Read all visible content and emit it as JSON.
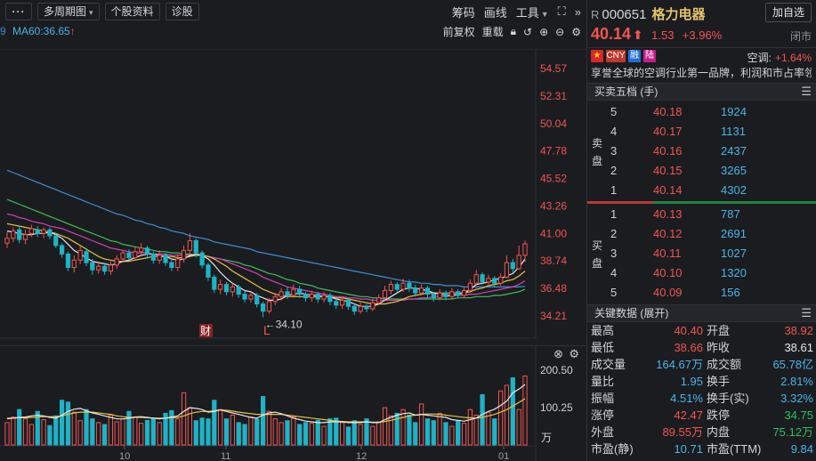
{
  "toolbar": {
    "menu_label": "···",
    "period_label": "多周期图",
    "profile_label": "个股资料",
    "diagnose_label": "诊股",
    "chips_label": "筹码",
    "draw_label": "画线",
    "tools_label": "工具"
  },
  "indicators": {
    "ma_prev_tail": "9",
    "ma60_label": "MA60:36.65",
    "ma60_arrow": "↑",
    "adjust_label": "前复权",
    "overlay_label": "重载"
  },
  "main_chart": {
    "price_ticks": [
      "54.57",
      "52.31",
      "50.04",
      "47.78",
      "45.52",
      "43.26",
      "41.00",
      "38.74",
      "36.48",
      "34.21"
    ],
    "tick_min": 34.21,
    "tick_max": 54.57,
    "low_annotation": "←34.10",
    "low_value": 34.1,
    "badge_finance": "财",
    "badge_l": "L",
    "colors": {
      "up": "#f2554f",
      "down": "#1fb3c6",
      "ma5": "#e8e8e8",
      "ma10": "#e7c244",
      "ma20": "#d53fb6",
      "ma30": "#3fbf59",
      "ma60": "#3b8fd9"
    },
    "candles": [
      {
        "o": 40.2,
        "c": 40.6,
        "h": 41.1,
        "l": 39.8
      },
      {
        "o": 40.6,
        "c": 41.2,
        "h": 41.5,
        "l": 40.3
      },
      {
        "o": 41.3,
        "c": 40.5,
        "h": 41.6,
        "l": 40.2
      },
      {
        "o": 40.5,
        "c": 40.9,
        "h": 41.3,
        "l": 40.1
      },
      {
        "o": 41.0,
        "c": 41.4,
        "h": 41.7,
        "l": 40.7
      },
      {
        "o": 41.3,
        "c": 41.0,
        "h": 41.6,
        "l": 40.7
      },
      {
        "o": 41.0,
        "c": 41.3,
        "h": 41.5,
        "l": 40.6
      },
      {
        "o": 41.3,
        "c": 40.8,
        "h": 41.5,
        "l": 40.5
      },
      {
        "o": 40.8,
        "c": 40.0,
        "h": 41.0,
        "l": 39.8
      },
      {
        "o": 40.0,
        "c": 39.3,
        "h": 40.2,
        "l": 39.0
      },
      {
        "o": 39.3,
        "c": 38.2,
        "h": 39.5,
        "l": 37.9
      },
      {
        "o": 38.2,
        "c": 38.8,
        "h": 39.2,
        "l": 37.8
      },
      {
        "o": 38.8,
        "c": 39.6,
        "h": 40.0,
        "l": 38.5
      },
      {
        "o": 39.5,
        "c": 38.6,
        "h": 39.8,
        "l": 38.3
      },
      {
        "o": 38.6,
        "c": 38.0,
        "h": 38.9,
        "l": 37.6
      },
      {
        "o": 38.0,
        "c": 38.3,
        "h": 38.6,
        "l": 37.7
      },
      {
        "o": 38.3,
        "c": 37.9,
        "h": 38.6,
        "l": 37.6
      },
      {
        "o": 37.9,
        "c": 38.4,
        "h": 38.7,
        "l": 37.6
      },
      {
        "o": 38.4,
        "c": 38.9,
        "h": 39.2,
        "l": 38.1
      },
      {
        "o": 38.9,
        "c": 39.4,
        "h": 39.6,
        "l": 38.6
      },
      {
        "o": 39.4,
        "c": 39.0,
        "h": 39.7,
        "l": 38.8
      },
      {
        "o": 39.0,
        "c": 39.5,
        "h": 39.9,
        "l": 38.8
      },
      {
        "o": 39.5,
        "c": 39.8,
        "h": 40.2,
        "l": 39.2
      },
      {
        "o": 39.8,
        "c": 39.3,
        "h": 40.0,
        "l": 39.0
      },
      {
        "o": 39.3,
        "c": 38.8,
        "h": 39.5,
        "l": 38.5
      },
      {
        "o": 38.8,
        "c": 39.2,
        "h": 39.6,
        "l": 38.5
      },
      {
        "o": 39.2,
        "c": 38.6,
        "h": 39.4,
        "l": 38.3
      },
      {
        "o": 38.6,
        "c": 38.2,
        "h": 38.9,
        "l": 37.9
      },
      {
        "o": 38.2,
        "c": 38.9,
        "h": 39.3,
        "l": 37.9
      },
      {
        "o": 38.9,
        "c": 39.6,
        "h": 40.0,
        "l": 38.6
      },
      {
        "o": 39.6,
        "c": 40.4,
        "h": 41.0,
        "l": 39.3
      },
      {
        "o": 40.4,
        "c": 39.4,
        "h": 40.6,
        "l": 39.0
      },
      {
        "o": 39.4,
        "c": 38.4,
        "h": 39.6,
        "l": 38.1
      },
      {
        "o": 38.4,
        "c": 37.4,
        "h": 38.6,
        "l": 37.1
      },
      {
        "o": 37.4,
        "c": 36.4,
        "h": 37.6,
        "l": 36.1
      },
      {
        "o": 36.4,
        "c": 36.8,
        "h": 37.2,
        "l": 36.0
      },
      {
        "o": 36.8,
        "c": 36.2,
        "h": 37.0,
        "l": 35.9
      },
      {
        "o": 36.2,
        "c": 36.6,
        "h": 36.9,
        "l": 35.8
      },
      {
        "o": 36.6,
        "c": 36.0,
        "h": 36.8,
        "l": 35.7
      },
      {
        "o": 36.0,
        "c": 35.6,
        "h": 36.3,
        "l": 35.3
      },
      {
        "o": 35.6,
        "c": 35.9,
        "h": 36.2,
        "l": 35.3
      },
      {
        "o": 35.9,
        "c": 35.2,
        "h": 36.1,
        "l": 34.9
      },
      {
        "o": 35.2,
        "c": 34.6,
        "h": 35.4,
        "l": 34.1
      },
      {
        "o": 34.6,
        "c": 35.4,
        "h": 35.7,
        "l": 34.4
      },
      {
        "o": 35.4,
        "c": 35.8,
        "h": 36.1,
        "l": 35.1
      },
      {
        "o": 35.8,
        "c": 36.2,
        "h": 36.5,
        "l": 35.5
      },
      {
        "o": 36.2,
        "c": 35.9,
        "h": 36.6,
        "l": 35.6
      },
      {
        "o": 35.9,
        "c": 36.4,
        "h": 36.8,
        "l": 35.7
      },
      {
        "o": 36.4,
        "c": 36.0,
        "h": 36.7,
        "l": 35.7
      },
      {
        "o": 36.0,
        "c": 35.7,
        "h": 36.2,
        "l": 35.4
      },
      {
        "o": 35.7,
        "c": 36.0,
        "h": 36.3,
        "l": 35.4
      },
      {
        "o": 36.0,
        "c": 35.6,
        "h": 36.2,
        "l": 35.3
      },
      {
        "o": 35.6,
        "c": 35.9,
        "h": 36.2,
        "l": 35.3
      },
      {
        "o": 35.9,
        "c": 35.4,
        "h": 36.1,
        "l": 35.1
      },
      {
        "o": 35.4,
        "c": 35.1,
        "h": 35.6,
        "l": 34.8
      },
      {
        "o": 35.1,
        "c": 35.5,
        "h": 35.8,
        "l": 34.8
      },
      {
        "o": 35.5,
        "c": 35.0,
        "h": 35.7,
        "l": 34.7
      },
      {
        "o": 35.0,
        "c": 34.6,
        "h": 35.2,
        "l": 34.3
      },
      {
        "o": 34.6,
        "c": 35.0,
        "h": 35.3,
        "l": 34.4
      },
      {
        "o": 35.0,
        "c": 34.8,
        "h": 35.2,
        "l": 34.5
      },
      {
        "o": 34.8,
        "c": 35.3,
        "h": 35.6,
        "l": 34.6
      },
      {
        "o": 35.3,
        "c": 35.7,
        "h": 36.0,
        "l": 35.1
      },
      {
        "o": 35.7,
        "c": 36.3,
        "h": 36.7,
        "l": 35.5
      },
      {
        "o": 36.3,
        "c": 36.8,
        "h": 37.1,
        "l": 36.0
      },
      {
        "o": 36.8,
        "c": 36.4,
        "h": 37.0,
        "l": 36.1
      },
      {
        "o": 36.4,
        "c": 36.9,
        "h": 37.3,
        "l": 36.2
      },
      {
        "o": 36.9,
        "c": 36.5,
        "h": 37.2,
        "l": 36.2
      },
      {
        "o": 36.5,
        "c": 36.1,
        "h": 36.8,
        "l": 35.8
      },
      {
        "o": 36.1,
        "c": 36.5,
        "h": 36.8,
        "l": 35.9
      },
      {
        "o": 36.5,
        "c": 36.0,
        "h": 36.7,
        "l": 35.7
      },
      {
        "o": 36.0,
        "c": 35.7,
        "h": 36.2,
        "l": 35.4
      },
      {
        "o": 35.7,
        "c": 36.1,
        "h": 36.4,
        "l": 35.5
      },
      {
        "o": 36.1,
        "c": 35.8,
        "h": 36.3,
        "l": 35.5
      },
      {
        "o": 35.8,
        "c": 36.2,
        "h": 36.5,
        "l": 35.6
      },
      {
        "o": 36.2,
        "c": 35.9,
        "h": 36.4,
        "l": 35.7
      },
      {
        "o": 35.9,
        "c": 36.3,
        "h": 36.6,
        "l": 35.7
      },
      {
        "o": 36.3,
        "c": 36.9,
        "h": 37.2,
        "l": 36.1
      },
      {
        "o": 36.9,
        "c": 37.6,
        "h": 38.0,
        "l": 36.7
      },
      {
        "o": 37.6,
        "c": 37.0,
        "h": 37.8,
        "l": 36.8
      },
      {
        "o": 37.0,
        "c": 37.3,
        "h": 37.6,
        "l": 36.8
      },
      {
        "o": 37.3,
        "c": 36.9,
        "h": 37.5,
        "l": 36.6
      },
      {
        "o": 36.9,
        "c": 37.4,
        "h": 37.7,
        "l": 36.7
      },
      {
        "o": 37.4,
        "c": 38.6,
        "h": 39.2,
        "l": 37.3
      },
      {
        "o": 38.6,
        "c": 38.1,
        "h": 38.9,
        "l": 37.8
      },
      {
        "o": 38.1,
        "c": 39.2,
        "h": 40.0,
        "l": 38.0
      },
      {
        "o": 39.2,
        "c": 40.14,
        "h": 40.4,
        "l": 38.66
      }
    ],
    "ma5": [
      41.2,
      41.1,
      41.0,
      40.9,
      40.9,
      41.0,
      41.0,
      41.1,
      40.9,
      40.6,
      40.1,
      39.6,
      39.3,
      39.0,
      38.7,
      38.6,
      38.5,
      38.4,
      38.5,
      38.7,
      38.8,
      39.0,
      39.2,
      39.3,
      39.3,
      39.2,
      39.1,
      38.9,
      38.8,
      38.9,
      39.2,
      39.3,
      39.2,
      38.9,
      38.4,
      37.8,
      37.3,
      36.9,
      36.6,
      36.3,
      36.2,
      35.9,
      35.7,
      35.5,
      35.5,
      35.6,
      35.9,
      36.0,
      36.1,
      36.0,
      35.9,
      35.9,
      35.8,
      35.8,
      35.6,
      35.5,
      35.4,
      35.2,
      35.0,
      35.0,
      35.0,
      35.2,
      35.5,
      35.8,
      36.1,
      36.4,
      36.5,
      36.5,
      36.4,
      36.3,
      36.1,
      36.0,
      35.9,
      35.9,
      36.0,
      36.1,
      36.4,
      36.8,
      36.9,
      37.0,
      37.2,
      37.3,
      37.5,
      37.7,
      38.2,
      38.9
    ],
    "ma10": [
      41.8,
      41.7,
      41.6,
      41.5,
      41.4,
      41.3,
      41.2,
      41.1,
      41.0,
      40.8,
      40.6,
      40.3,
      40.0,
      39.7,
      39.4,
      39.1,
      38.9,
      38.8,
      38.7,
      38.7,
      38.7,
      38.8,
      38.9,
      39.0,
      39.1,
      39.1,
      39.1,
      39.1,
      39.0,
      39.0,
      39.1,
      39.2,
      39.2,
      39.1,
      38.9,
      38.6,
      38.3,
      37.9,
      37.6,
      37.3,
      37.0,
      36.7,
      36.4,
      36.2,
      36.0,
      35.9,
      35.8,
      35.8,
      35.8,
      35.8,
      35.8,
      35.8,
      35.8,
      35.8,
      35.7,
      35.7,
      35.6,
      35.5,
      35.4,
      35.3,
      35.2,
      35.2,
      35.2,
      35.3,
      35.4,
      35.6,
      35.8,
      35.9,
      36.0,
      36.1,
      36.1,
      36.1,
      36.1,
      36.1,
      36.1,
      36.1,
      36.2,
      36.4,
      36.5,
      36.7,
      36.8,
      36.9,
      37.1,
      37.2,
      37.5,
      37.9
    ],
    "ma20": [
      42.6,
      42.5,
      42.3,
      42.2,
      42.0,
      41.9,
      41.8,
      41.6,
      41.5,
      41.4,
      41.2,
      41.0,
      40.8,
      40.6,
      40.4,
      40.2,
      40.0,
      39.8,
      39.7,
      39.6,
      39.5,
      39.4,
      39.4,
      39.4,
      39.3,
      39.3,
      39.3,
      39.2,
      39.2,
      39.2,
      39.2,
      39.2,
      39.2,
      39.1,
      39.0,
      38.9,
      38.7,
      38.5,
      38.3,
      38.1,
      37.9,
      37.7,
      37.4,
      37.2,
      37.0,
      36.8,
      36.6,
      36.5,
      36.4,
      36.3,
      36.2,
      36.1,
      36.0,
      35.9,
      35.8,
      35.8,
      35.7,
      35.7,
      35.6,
      35.6,
      35.5,
      35.5,
      35.5,
      35.5,
      35.5,
      35.5,
      35.6,
      35.6,
      35.7,
      35.7,
      35.8,
      35.8,
      35.8,
      35.9,
      35.9,
      35.9,
      36.0,
      36.0,
      36.1,
      36.2,
      36.3,
      36.4,
      36.5,
      36.6,
      36.8,
      37.1
    ],
    "ma30": [
      43.8,
      43.6,
      43.4,
      43.2,
      43.0,
      42.8,
      42.6,
      42.4,
      42.2,
      42.0,
      41.8,
      41.6,
      41.4,
      41.2,
      41.0,
      40.8,
      40.6,
      40.4,
      40.3,
      40.1,
      40.0,
      39.9,
      39.8,
      39.7,
      39.6,
      39.5,
      39.5,
      39.4,
      39.4,
      39.3,
      39.3,
      39.2,
      39.2,
      39.1,
      39.0,
      38.9,
      38.8,
      38.7,
      38.6,
      38.4,
      38.3,
      38.1,
      37.9,
      37.7,
      37.6,
      37.4,
      37.2,
      37.1,
      36.9,
      36.8,
      36.7,
      36.5,
      36.4,
      36.3,
      36.2,
      36.1,
      36.0,
      35.9,
      35.8,
      35.8,
      35.7,
      35.7,
      35.6,
      35.6,
      35.6,
      35.6,
      35.6,
      35.6,
      35.6,
      35.6,
      35.6,
      35.6,
      35.6,
      35.6,
      35.7,
      35.7,
      35.7,
      35.8,
      35.8,
      35.8,
      35.9,
      35.9,
      36.0,
      36.1,
      36.2,
      36.4
    ],
    "ma60": [
      46.2,
      46.0,
      45.8,
      45.6,
      45.4,
      45.2,
      45.0,
      44.8,
      44.6,
      44.4,
      44.2,
      44.0,
      43.8,
      43.6,
      43.4,
      43.2,
      43.0,
      42.8,
      42.6,
      42.5,
      42.3,
      42.1,
      42.0,
      41.8,
      41.7,
      41.5,
      41.4,
      41.2,
      41.1,
      41.0,
      40.8,
      40.7,
      40.6,
      40.5,
      40.3,
      40.2,
      40.1,
      40.0,
      39.9,
      39.8,
      39.7,
      39.5,
      39.4,
      39.3,
      39.2,
      39.1,
      39.0,
      38.9,
      38.8,
      38.7,
      38.6,
      38.5,
      38.4,
      38.3,
      38.2,
      38.1,
      38.0,
      37.9,
      37.8,
      37.7,
      37.6,
      37.5,
      37.4,
      37.3,
      37.2,
      37.1,
      37.0,
      37.0,
      36.9,
      36.9,
      36.8,
      36.8,
      36.7,
      36.7,
      36.7,
      36.6,
      36.6,
      36.6,
      36.6,
      36.6,
      36.6,
      36.6,
      36.6,
      36.6,
      36.6,
      36.65
    ]
  },
  "volume_chart": {
    "ticks": [
      "200.50",
      "100.25"
    ],
    "tick_values": [
      200.5,
      100.25
    ],
    "unit_label": "万",
    "x_labels": [
      "10",
      "11",
      "12",
      "01"
    ],
    "values": [
      60,
      75,
      95,
      70,
      55,
      90,
      68,
      52,
      78,
      120,
      115,
      88,
      65,
      95,
      70,
      60,
      55,
      80,
      62,
      70,
      90,
      75,
      58,
      66,
      72,
      60,
      85,
      92,
      70,
      140,
      100,
      65,
      72,
      70,
      120,
      95,
      70,
      80,
      60,
      55,
      75,
      70,
      130,
      90,
      70,
      60,
      65,
      75,
      55,
      60,
      58,
      66,
      50,
      70,
      72,
      60,
      48,
      65,
      55,
      70,
      50,
      62,
      100,
      78,
      85,
      95,
      80,
      60,
      110,
      70,
      65,
      85,
      60,
      50,
      66,
      58,
      95,
      80,
      135,
      88,
      70,
      145,
      160,
      180,
      95,
      185
    ],
    "ma5": [
      70,
      72,
      74,
      75,
      78,
      80,
      78,
      74,
      72,
      80,
      90,
      96,
      98,
      92,
      86,
      82,
      78,
      74,
      70,
      70,
      72,
      75,
      76,
      74,
      72,
      70,
      72,
      75,
      78,
      90,
      100,
      98,
      95,
      88,
      90,
      94,
      90,
      86,
      82,
      78,
      74,
      72,
      80,
      86,
      88,
      84,
      78,
      72,
      68,
      64,
      62,
      60,
      60,
      62,
      62,
      62,
      60,
      60,
      60,
      62,
      60,
      60,
      68,
      74,
      80,
      84,
      86,
      80,
      82,
      80,
      78,
      76,
      74,
      68,
      66,
      64,
      68,
      72,
      82,
      90,
      96,
      106,
      118,
      140,
      150,
      162
    ],
    "ma10": [
      72,
      72,
      73,
      73,
      74,
      75,
      76,
      76,
      76,
      78,
      82,
      86,
      88,
      88,
      88,
      86,
      84,
      82,
      78,
      76,
      74,
      74,
      74,
      73,
      72,
      72,
      72,
      73,
      74,
      78,
      84,
      88,
      90,
      90,
      92,
      94,
      93,
      91,
      88,
      86,
      84,
      82,
      82,
      82,
      82,
      82,
      80,
      78,
      76,
      74,
      72,
      70,
      68,
      66,
      64,
      63,
      62,
      62,
      62,
      62,
      61,
      61,
      63,
      66,
      70,
      74,
      78,
      80,
      82,
      83,
      83,
      82,
      80,
      78,
      76,
      74,
      73,
      72,
      74,
      78,
      82,
      88,
      95,
      104,
      114,
      124
    ]
  },
  "quote": {
    "r_mark": "R",
    "code": "000651",
    "name": "格力电器",
    "add_label": "加自选",
    "price": "40.14",
    "price_arrow": "⬆",
    "change": "1.53",
    "change_pct": "+3.96%",
    "status": "闭市",
    "tags": [
      "CNY",
      "融",
      "陆"
    ],
    "air_label": "空调:",
    "air_value": "+1.64%",
    "desc": "享誉全球的空调行业第一品牌，利润和市占率领先"
  },
  "orderbook": {
    "title": "买卖五档 (手)",
    "sell_side_label": "卖盘",
    "buy_side_label": "买盘",
    "sell": [
      {
        "level": "5",
        "price": "40.18",
        "qty": "1924"
      },
      {
        "level": "4",
        "price": "40.17",
        "qty": "1131"
      },
      {
        "level": "3",
        "price": "40.16",
        "qty": "2437"
      },
      {
        "level": "2",
        "price": "40.15",
        "qty": "3265"
      },
      {
        "level": "1",
        "price": "40.14",
        "qty": "4302"
      }
    ],
    "buy": [
      {
        "level": "1",
        "price": "40.13",
        "qty": "787"
      },
      {
        "level": "2",
        "price": "40.12",
        "qty": "2691"
      },
      {
        "level": "3",
        "price": "40.11",
        "qty": "1027"
      },
      {
        "level": "4",
        "price": "40.10",
        "qty": "1320"
      },
      {
        "level": "5",
        "price": "40.09",
        "qty": "156"
      }
    ]
  },
  "stats": {
    "title": "关键数据 (展开)",
    "rows": [
      {
        "k1": "最高",
        "v1": "40.40",
        "c1": "red",
        "k2": "开盘",
        "v2": "38.92",
        "c2": "red"
      },
      {
        "k1": "最低",
        "v1": "38.66",
        "c1": "red",
        "k2": "昨收",
        "v2": "38.61",
        "c2": "wht"
      },
      {
        "k1": "成交量",
        "v1": "164.67万",
        "c1": "blu",
        "k2": "成交额",
        "v2": "65.78亿",
        "c2": "blu"
      },
      {
        "k1": "量比",
        "v1": "1.95",
        "c1": "blu",
        "k2": "换手",
        "v2": "2.81%",
        "c2": "blu"
      },
      {
        "k1": "振幅",
        "v1": "4.51%",
        "c1": "blu",
        "k2": "换手(实)",
        "v2": "3.32%",
        "c2": "blu"
      },
      {
        "k1": "涨停",
        "v1": "42.47",
        "c1": "red",
        "k2": "跌停",
        "v2": "34.75",
        "c2": "grn"
      },
      {
        "k1": "外盘",
        "v1": "89.55万",
        "c1": "red",
        "k2": "内盘",
        "v2": "75.12万",
        "c2": "grn"
      },
      {
        "k1": "市盈(静)",
        "v1": "10.71",
        "c1": "blu",
        "k2": "市盈(TTM)",
        "v2": "9.84",
        "c2": "blu"
      }
    ]
  }
}
